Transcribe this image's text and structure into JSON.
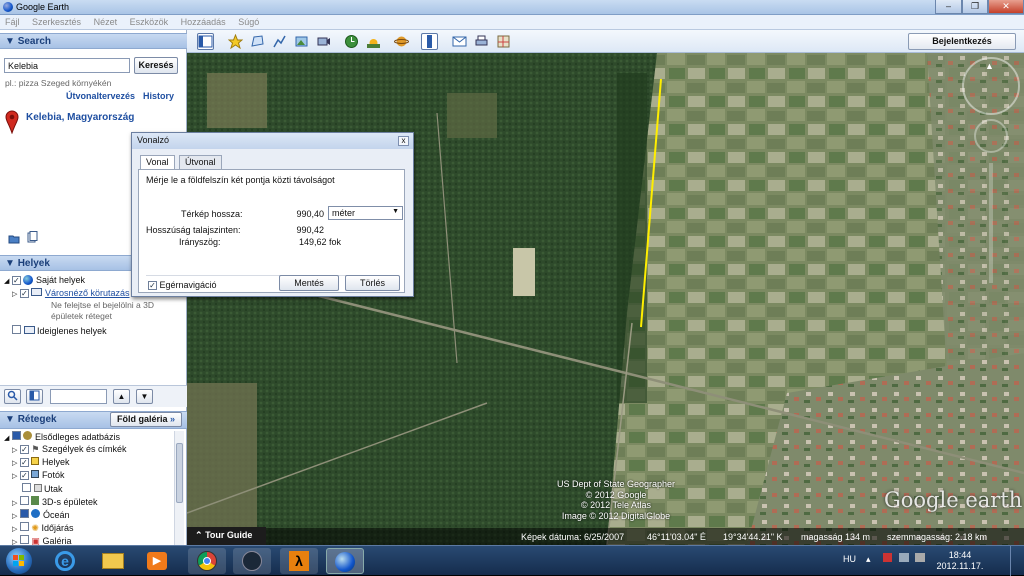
{
  "window": {
    "title": "Google Earth",
    "minimize": "–",
    "maximize": "❐",
    "close": "✕"
  },
  "menu": [
    "Fájl",
    "Szerkesztés",
    "Nézet",
    "Eszközök",
    "Hozzáadás",
    "Súgó"
  ],
  "toolbar": {
    "signin_label": "Bejelentkezés"
  },
  "search": {
    "header": "Search",
    "query": "Kelebia",
    "button": "Keresés",
    "hint": "pl.: pizza Szeged környékén",
    "link_directions": "Útvonaltervezés",
    "link_history": "History",
    "result": "Kelebia, Magyarország"
  },
  "places": {
    "header": "Helyek",
    "items": [
      {
        "label": "Saját helyek"
      },
      {
        "label": "Városnéző körutazás",
        "note": "Ne felejtse el bejelölni a 3D épületek réteget"
      },
      {
        "label": "Ideiglenes helyek"
      }
    ]
  },
  "layers": {
    "header": "Rétegek",
    "gallery_button": "Föld galéria",
    "items": [
      "Elsődleges adatbázis",
      "Szegélyek és címkék",
      "Helyek",
      "Fotók",
      "Utak",
      "3D-s épületek",
      "Óceán",
      "Időjárás",
      "Galéria"
    ]
  },
  "tour_guide": "Tour Guide",
  "ruler": {
    "title": "Vonalzó",
    "tab_line": "Vonal",
    "tab_path": "Útvonal",
    "description": "Mérje le a földfelszín két pontja közti távolságot",
    "map_length_label": "Térkép hossza:",
    "map_length_value": "990,40",
    "unit": "méter",
    "ground_length_label": "Hosszúság talajszinten:",
    "ground_length_value": "990,42",
    "heading_label": "Irányszög:",
    "heading_value": "149,62 fok",
    "mouse_nav": "Egérnavigáció",
    "save": "Mentés",
    "clear": "Törlés"
  },
  "attribution": [
    "US Dept of State Geographer",
    "© 2012 Google",
    "© 2012 Tele Atlas",
    "Image © 2012 DigitalGlobe"
  ],
  "logo": "Google earth",
  "status": {
    "image_date": "Képek dátuma: 6/25/2007",
    "lat": "46°11'03.04\" É",
    "lon": "19°34'44.21\" K",
    "elevation": "magasság   134 m",
    "eye_alt": "szemmagasság:   2.18 km"
  },
  "tray": {
    "lang": "HU",
    "time": "18:44",
    "date": "2012.11.17."
  }
}
